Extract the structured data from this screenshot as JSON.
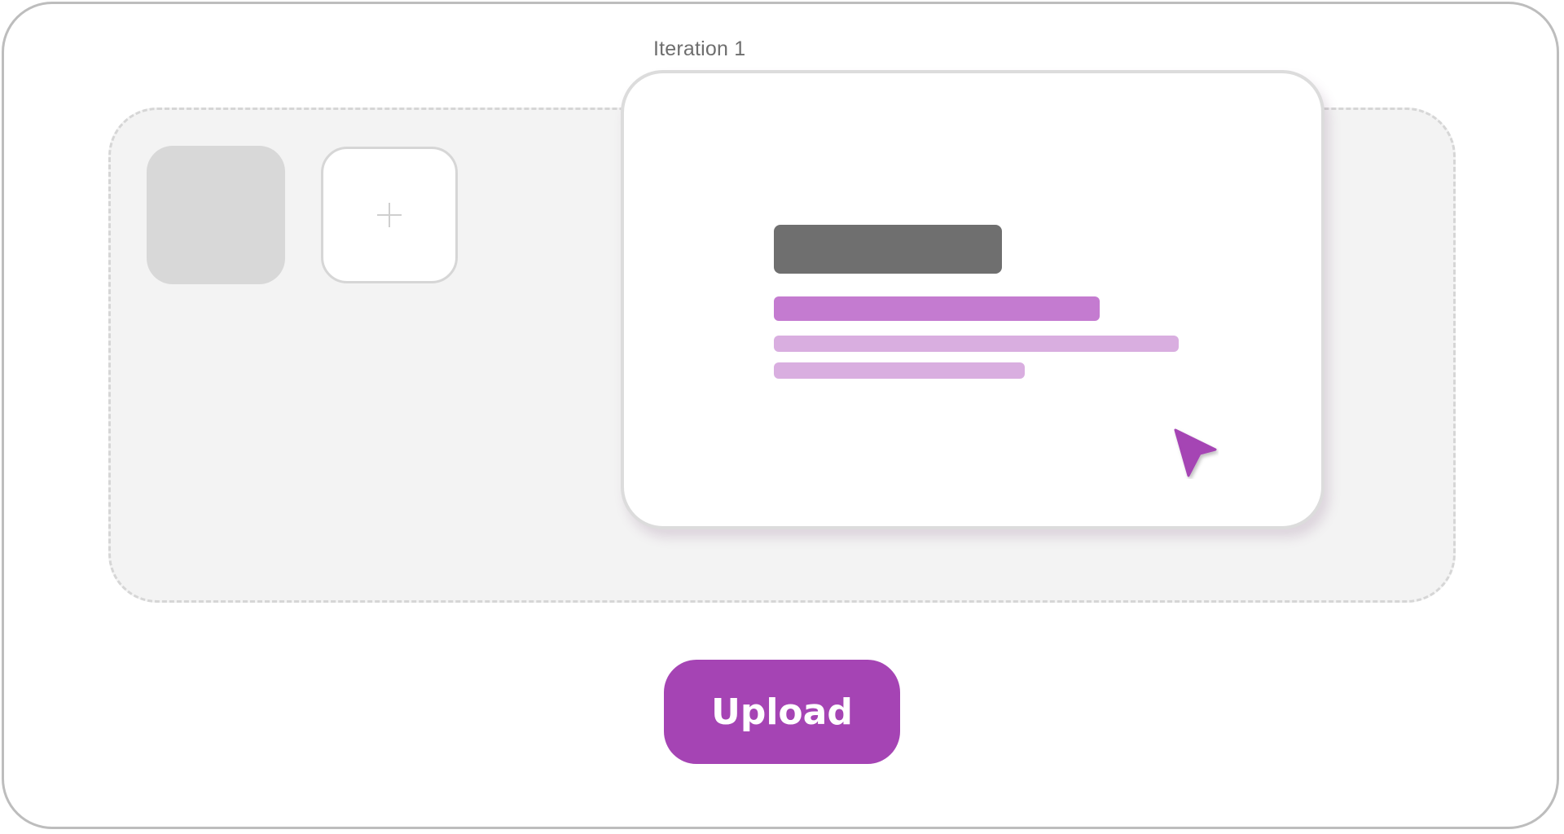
{
  "iteration": {
    "label": "Iteration 1"
  },
  "upload": {
    "label": "Upload"
  },
  "icons": {
    "add": "plus-icon",
    "pointer": "cursor-arrow-icon"
  },
  "colors": {
    "accent": "#a544b4",
    "accent_light": "#c47bd0",
    "accent_pale": "#d9aee0",
    "title_bar": "#6f6f6f",
    "thumb": "#d8d8d8"
  }
}
